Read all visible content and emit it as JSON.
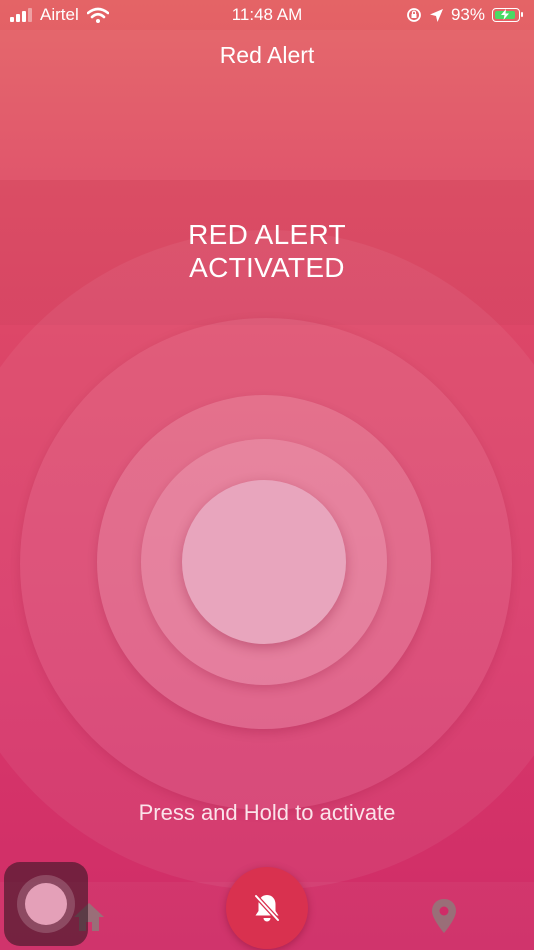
{
  "status_bar": {
    "carrier": "Airtel",
    "time": "11:48 AM",
    "battery": "93%",
    "battery_level": 0.93,
    "icons": [
      "signal-icon",
      "wifi-icon",
      "rotation-lock-icon",
      "location-arrow-icon",
      "battery-charging-icon"
    ]
  },
  "header": {
    "title": "Red Alert"
  },
  "alert": {
    "line1": "RED ALERT",
    "line2": "ACTIVATED"
  },
  "hint": "Press and Hold to activate",
  "nav": {
    "icons": [
      "home-icon",
      "bell-slash-icon",
      "location-pin-icon"
    ]
  },
  "colors": {
    "accent": "#d9314f",
    "background_top": "#e46466",
    "background_bottom": "#cf2c67",
    "charging": "#4bd964"
  }
}
